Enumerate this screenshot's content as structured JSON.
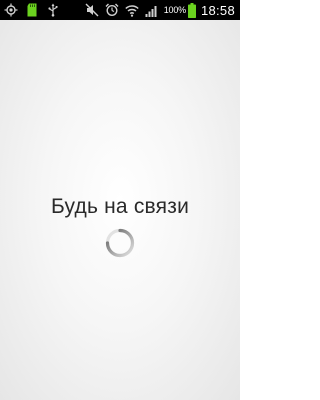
{
  "status_bar": {
    "icons_left": [
      "location-icon",
      "sd-card-icon",
      "usb-icon"
    ],
    "icons_right": [
      "mute-icon",
      "alarm-icon",
      "wifi-icon",
      "signal-icon"
    ],
    "battery_percent": "100%",
    "clock": "18:58",
    "colors": {
      "background": "#000000",
      "battery_green": "#6bd21f",
      "icon_grey": "#d0d0d0"
    }
  },
  "main": {
    "title": "Будь на связи",
    "loading_indicator": "spinner-icon",
    "colors": {
      "title": "#2a2a2a",
      "spinner": "#9a9a9a"
    }
  }
}
